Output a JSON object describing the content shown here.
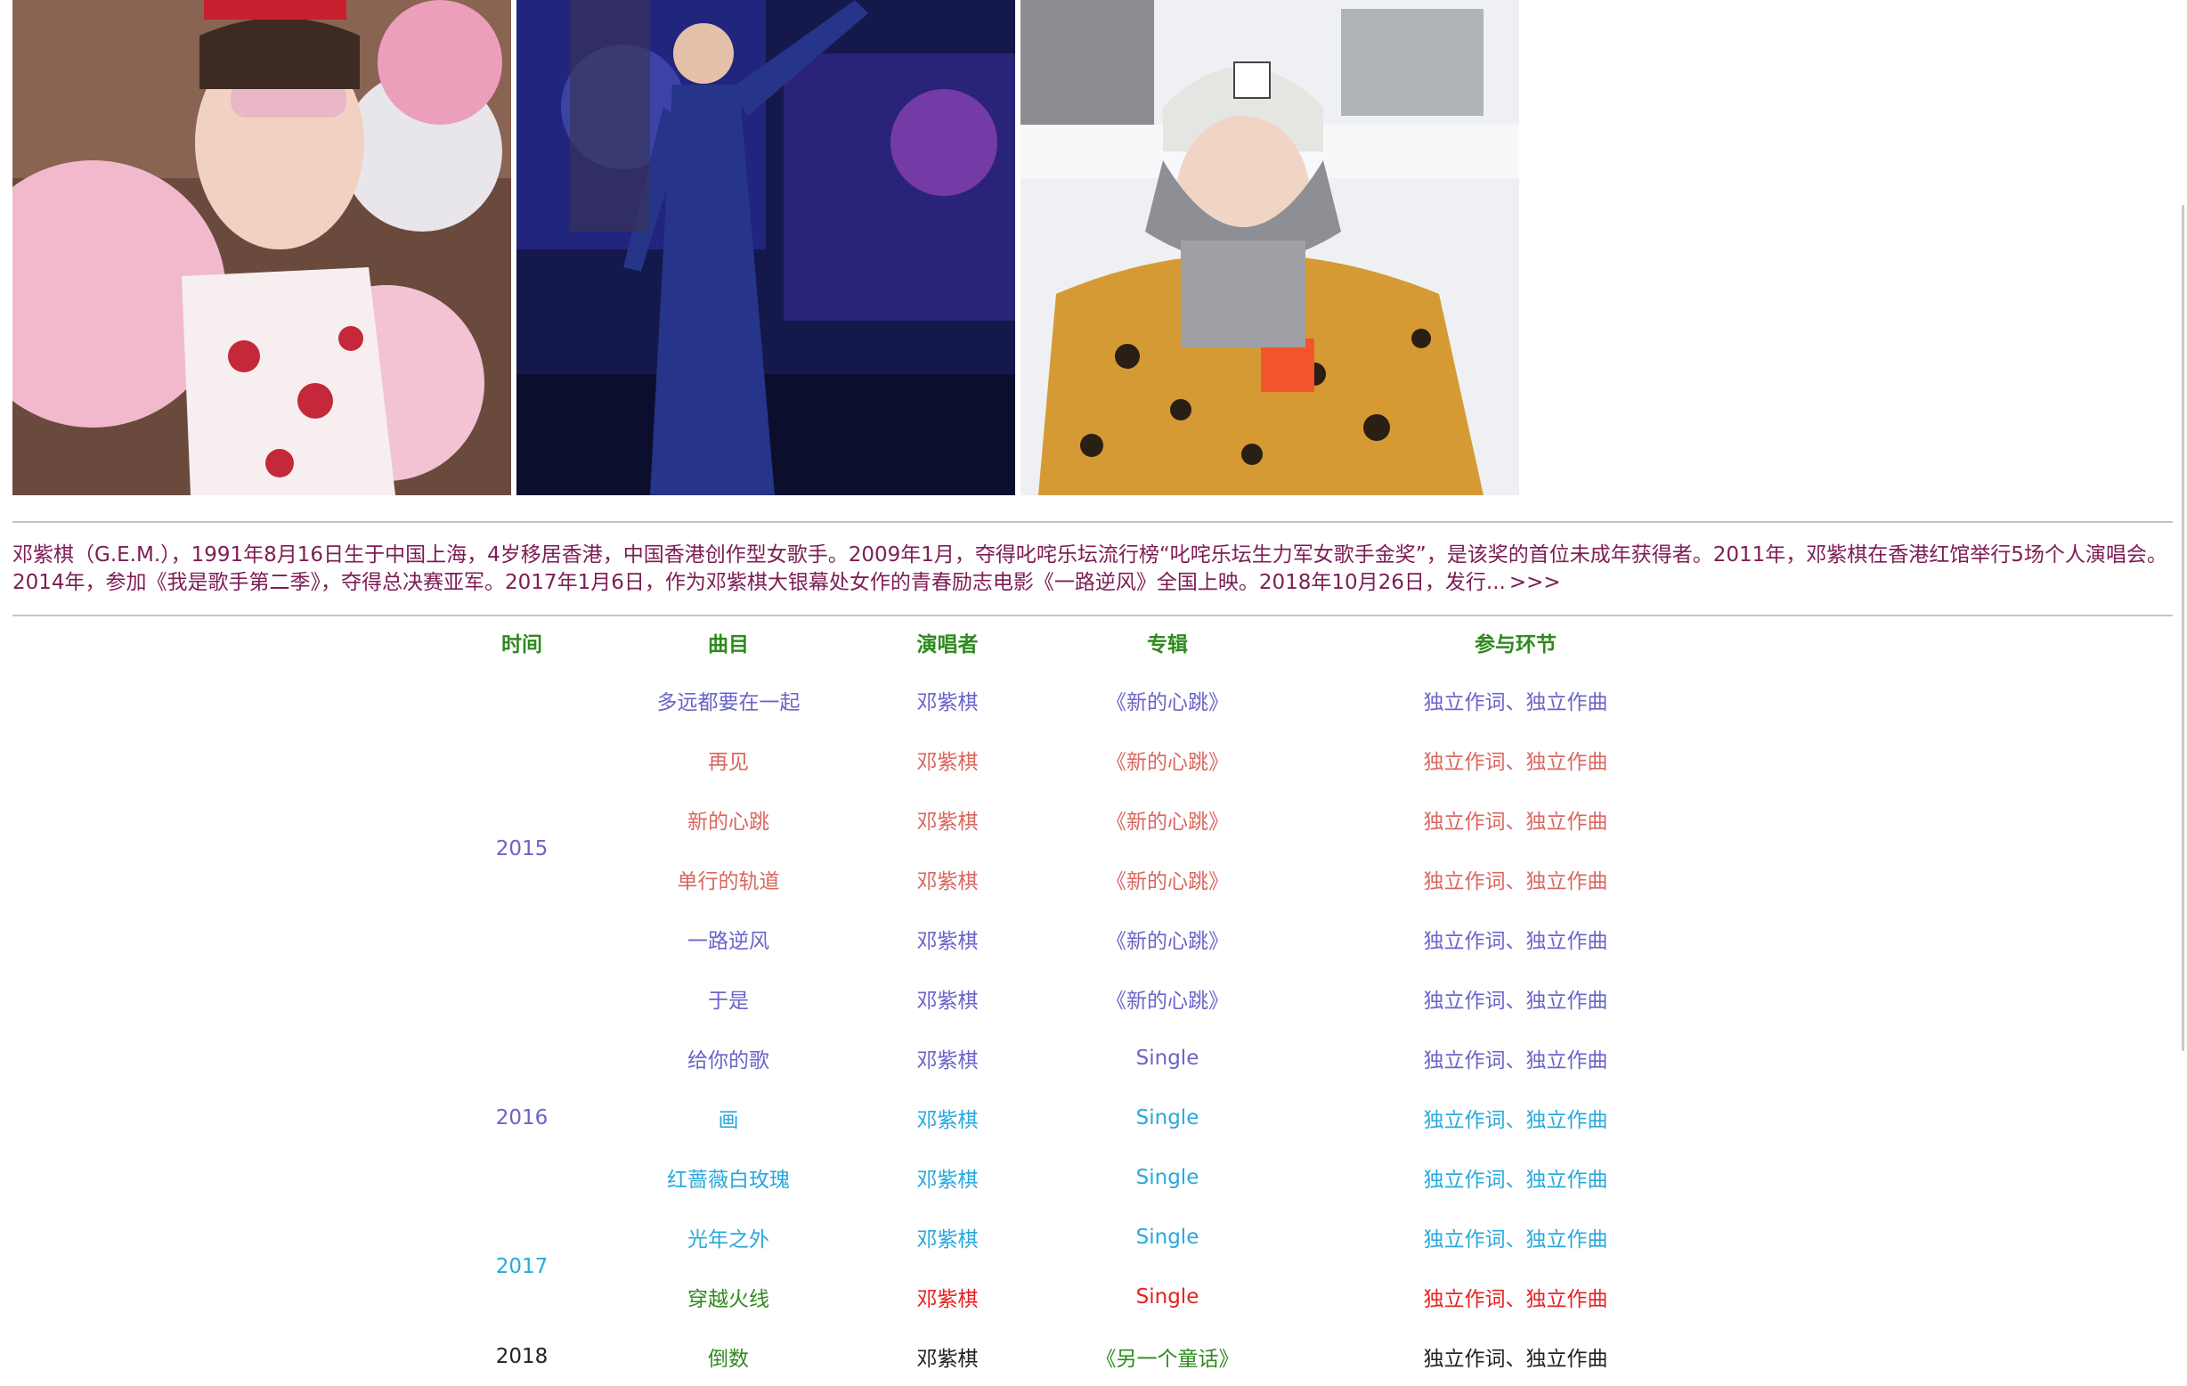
{
  "photos": [
    {
      "name": "balloons-photo",
      "bg": "#e9b6c9"
    },
    {
      "name": "stage-photo",
      "bg": "#1b1f5c"
    },
    {
      "name": "snow-photo",
      "bg": "#f0f1f3"
    }
  ],
  "intro": {
    "text": "邓紫棋（G.E.M.），1991年8月16日生于中国上海，4岁移居香港，中国香港创作型女歌手。2009年1月，夺得叱咤乐坛流行榜“叱咤乐坛生力军女歌手金奖”，是该奖的首位未成年获得者。2011年，邓紫棋在香港红馆举行5场个人演唱会。2014年，参加《我是歌手第二季》，夺得总决赛亚军。2017年1月6日，作为邓紫棋大银幕处女作的青春励志电影《一路逆风》全国上映。2018年10月26日，发行...",
    "more": ">>>",
    "color": "#7d1d54"
  },
  "table": {
    "headers": {
      "year": "时间",
      "song": "曲目",
      "singer": "演唱者",
      "album": "专辑",
      "role": "参与环节"
    },
    "header_color": "#2f8a1f",
    "years": {
      "y2015": "2015",
      "y2016": "2016",
      "y2017": "2017",
      "y2018": "2018"
    },
    "rows": [
      {
        "song": "多远都要在一起",
        "singer": "邓紫棋",
        "album": "《新的心跳》",
        "role": "独立作词、独立作曲",
        "color": "#6a64c8"
      },
      {
        "song": "再见",
        "singer": "邓紫棋",
        "album": "《新的心跳》",
        "role": "独立作词、独立作曲",
        "color": "#d9675f"
      },
      {
        "song": "新的心跳",
        "singer": "邓紫棋",
        "album": "《新的心跳》",
        "role": "独立作词、独立作曲",
        "color": "#d9675f"
      },
      {
        "song": "单行的轨道",
        "singer": "邓紫棋",
        "album": "《新的心跳》",
        "role": "独立作词、独立作曲",
        "color": "#d9675f"
      },
      {
        "song": "一路逆风",
        "singer": "邓紫棋",
        "album": "《新的心跳》",
        "role": "独立作词、独立作曲",
        "color": "#6a64c8"
      },
      {
        "song": "于是",
        "singer": "邓紫棋",
        "album": "《新的心跳》",
        "role": "独立作词、独立作曲",
        "color": "#6a64c8"
      },
      {
        "song": "给你的歌",
        "singer": "邓紫棋",
        "album": "Single",
        "role": "独立作词、独立作曲",
        "color": "#6a64c8"
      },
      {
        "song": "画",
        "singer": "邓紫棋",
        "album": "Single",
        "role": "独立作词、独立作曲",
        "color": "#29a8dc"
      },
      {
        "song": "红蔷薇白玫瑰",
        "singer": "邓紫棋",
        "album": "Single",
        "role": "独立作词、独立作曲",
        "color": "#29a8dc"
      },
      {
        "song": "光年之外",
        "singer": "邓紫棋",
        "album": "Single",
        "role": "独立作词、独立作曲",
        "color": "#29a8dc"
      },
      {
        "song": "穿越火线",
        "singer": "邓紫棋",
        "album": "Single",
        "role": "独立作词、独立作曲",
        "color": "#e8201e",
        "song_color": "#2f8a1f"
      },
      {
        "song": "倒数",
        "singer": "邓紫棋",
        "album": "《另一个童话》",
        "role": "独立作词、独立作曲",
        "color": "#222222",
        "song_color": "#2f8a1f",
        "album_color": "#2f8a1f"
      }
    ],
    "year_colors": {
      "y2015": "#6a64c8",
      "y2016": "#6a64c8",
      "y2017": "#29a8dc",
      "y2018": "#222222"
    }
  }
}
